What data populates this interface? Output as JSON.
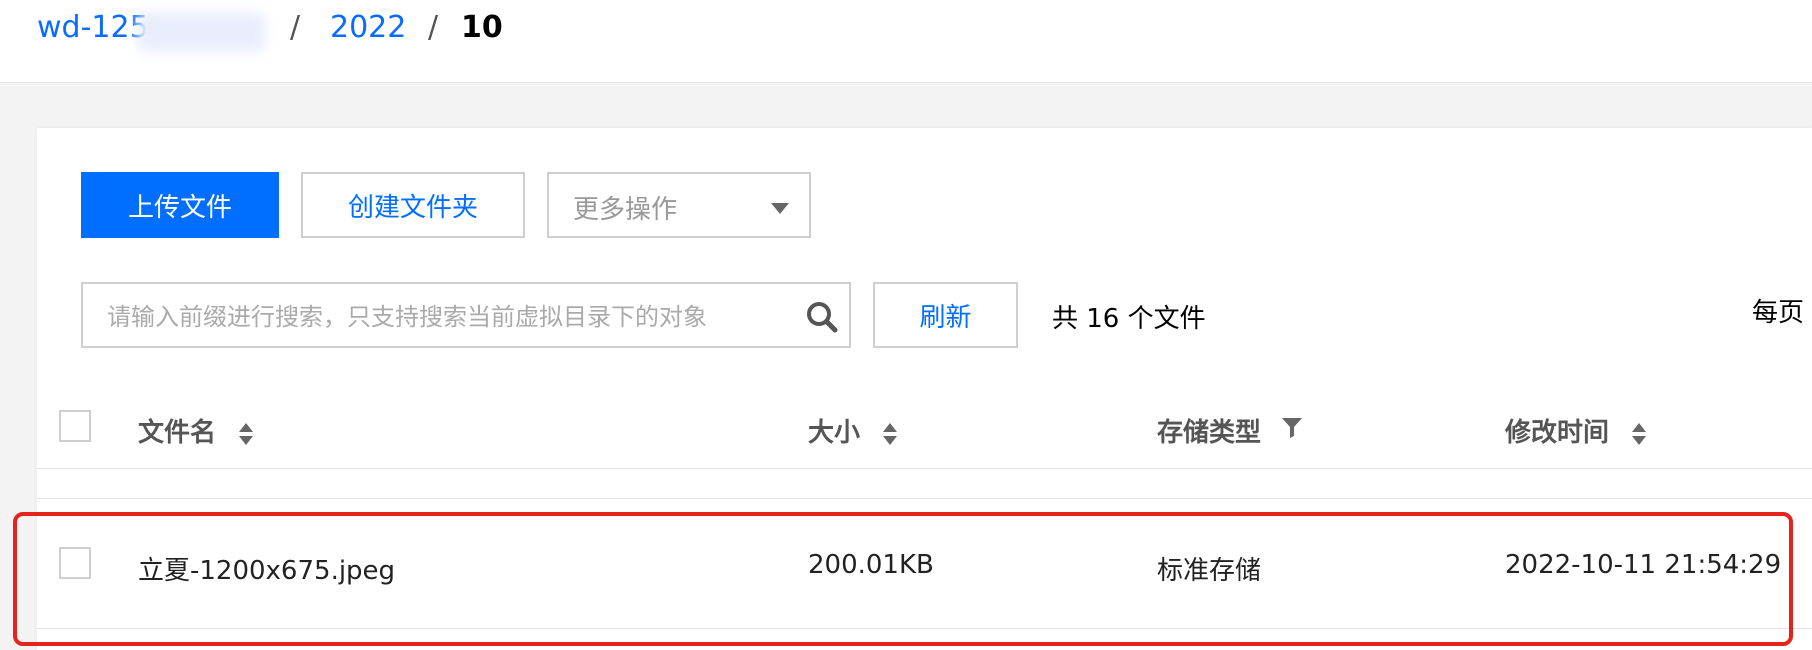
{
  "breadcrumb": {
    "bucket": "wd-125",
    "separator1": "/",
    "year": "2022",
    "separator2": "/",
    "current": "10"
  },
  "toolbar": {
    "upload_label": "上传文件",
    "create_folder_label": "创建文件夹",
    "more_actions_label": "更多操作"
  },
  "search": {
    "placeholder": "请输入前缀进行搜索，只支持搜索当前虚拟目录下的对象",
    "value": ""
  },
  "refresh_label": "刷新",
  "total_text": "共 16 个文件",
  "per_page_label": "每页",
  "table": {
    "columns": [
      "文件名",
      "大小",
      "存储类型",
      "修改时间"
    ],
    "rows": [
      {
        "name": "立夏-1200x675.jpeg",
        "size": "200.01KB",
        "storage_class": "标准存储",
        "modified": "2022-10-11 21:54:29"
      }
    ]
  },
  "colors": {
    "primary": "#006eff",
    "link": "#0a6cff",
    "highlight_border": "#e5221b"
  }
}
